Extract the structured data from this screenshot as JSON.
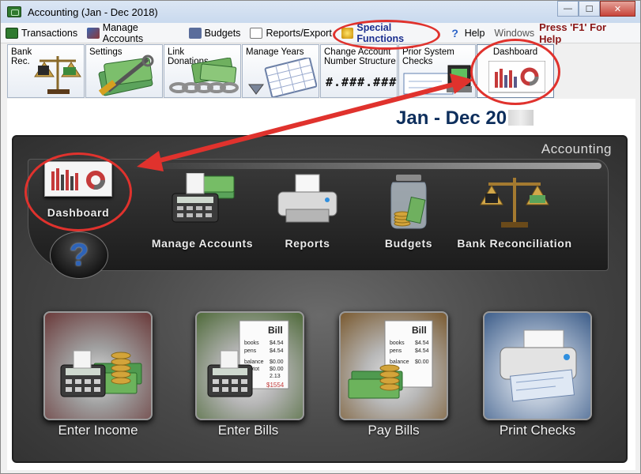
{
  "window": {
    "title": "Accounting (Jan - Dec 2018)",
    "controls": {
      "minimize": "—",
      "maximize": "☐",
      "close": "✕"
    }
  },
  "menubar": {
    "items": [
      {
        "label": "Transactions",
        "icon": "transactions-icon"
      },
      {
        "label": "Manage Accounts",
        "icon": "manage-accounts-icon"
      },
      {
        "label": "Budgets",
        "icon": "budgets-icon"
      },
      {
        "label": "Reports/Export",
        "icon": "reports-export-icon"
      },
      {
        "label": "Special Functions",
        "icon": "star-icon"
      },
      {
        "label": "Help",
        "icon": "help-icon"
      },
      {
        "label": "Windows",
        "icon": ""
      }
    ],
    "f1_hint": "Press 'F1' For Help"
  },
  "toolbar": {
    "bank_rec": "Bank\nRec.",
    "settings": "Settings",
    "link_donations": "Link\nDonations",
    "manage_years": "Manage Years",
    "change_account": "Change Account\nNumber Structure",
    "account_mask": "#.###.###",
    "prior_checks": "Prior System\nChecks",
    "dashboard": "Dashboard"
  },
  "header": {
    "date_range": "Jan - Dec 20"
  },
  "panel": {
    "title": "Accounting",
    "dashboard_label": "Dashboard",
    "help_glyph": "?",
    "nav": {
      "manage_accounts": "Manage Accounts",
      "reports": "Reports",
      "budgets": "Budgets",
      "bank_reconciliation": "Bank Reconciliation"
    },
    "tiles": {
      "enter_income": "Enter Income",
      "enter_bills": "Enter Bills",
      "pay_bills": "Pay Bills",
      "print_checks": "Print Checks"
    },
    "bill_text": {
      "bill": "Bill",
      "books": "books",
      "pens": "pens",
      "balance": "balance",
      "subtot": "subtot",
      "tax": "tax",
      "books_amt": "$4.54",
      "pens_amt": "$4.54",
      "balance_amt": "$0.00",
      "subtot_amt": "$0.00",
      "tax_amt": "2.13",
      "total": "$1554"
    }
  },
  "colors": {
    "annotation": "#e0322d",
    "panel_bg": "#4a4a4a",
    "heading": "#0d2e5c"
  }
}
